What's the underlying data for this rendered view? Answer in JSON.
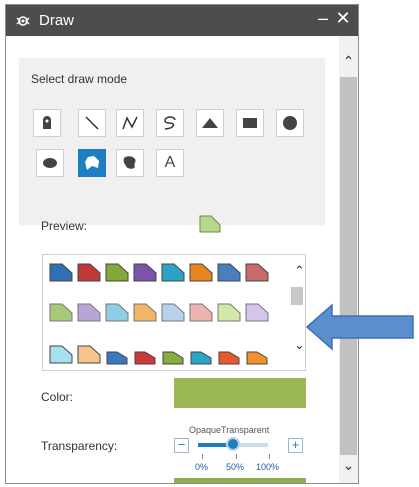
{
  "window": {
    "title": "Draw",
    "minimize_label": "–",
    "close_label": "✕"
  },
  "draw_mode": {
    "label": "Select draw mode",
    "tools": [
      {
        "name": "point-tool-button",
        "icon": "pin-icon"
      },
      {
        "name": "line-tool-button",
        "icon": "line-icon"
      },
      {
        "name": "polyline-tool-button",
        "icon": "polyline-icon"
      },
      {
        "name": "freehand-line-tool-button",
        "icon": "freehand-line-icon"
      },
      {
        "name": "triangle-tool-button",
        "icon": "triangle-icon"
      },
      {
        "name": "rectangle-tool-button",
        "icon": "rectangle-icon"
      },
      {
        "name": "circle-tool-button",
        "icon": "circle-icon"
      },
      {
        "name": "ellipse-tool-button",
        "icon": "ellipse-icon"
      },
      {
        "name": "polygon-tool-button",
        "icon": "polygon-icon",
        "selected": true
      },
      {
        "name": "freehand-polygon-tool-button",
        "icon": "freehand-polygon-icon"
      },
      {
        "name": "text-tool-button",
        "icon": "text-icon",
        "text": "A"
      }
    ]
  },
  "preview": {
    "label": "Preview:"
  },
  "symbols": {
    "rows": [
      [
        "#2f6fb3",
        "#c0383a",
        "#82a83a",
        "#7a54a8",
        "#2ba3c4",
        "#e8841e",
        "#4a7fbf",
        "#c96a6a"
      ],
      [
        "#a9c97a",
        "#b9a4d6",
        "#8fcde3",
        "#f2b566",
        "#b8cfee",
        "#ecb3b3",
        "#d2e8a6",
        "#d3c6ea"
      ],
      [
        "#a8dff0",
        "#f8c48e",
        "#3a78c2",
        "#cc3a3c",
        "#88ad3e",
        "#2ba6c5",
        "#e85a2a",
        "#f0922c"
      ]
    ],
    "scroll_up_label": "⌃",
    "scroll_down_label": "⌄"
  },
  "color": {
    "label": "Color:",
    "value": "#9bb855"
  },
  "transparency": {
    "label": "Transparency:",
    "left_title": "Opaque",
    "right_title": "Transparent",
    "minus_label": "−",
    "plus_label": "+",
    "value_fraction": 0.5,
    "ticks": [
      "0%",
      "50%",
      "100%"
    ]
  },
  "panel_scroll": {
    "up_label": "⌃",
    "down_label": "⌄"
  }
}
